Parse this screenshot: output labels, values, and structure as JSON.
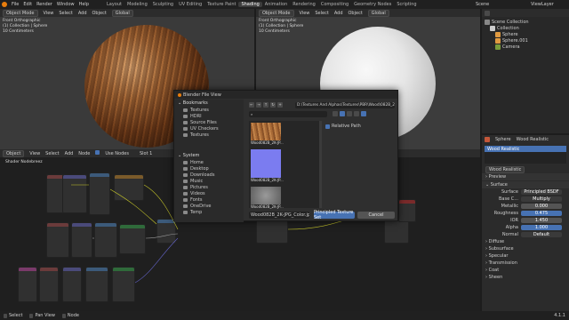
{
  "menu": [
    "File",
    "Edit",
    "Render",
    "Window",
    "Help"
  ],
  "workspaces": [
    "Layout",
    "Modeling",
    "Sculpting",
    "UV Editing",
    "Texture Paint",
    "Shading",
    "Animation",
    "Rendering",
    "Compositing",
    "Geometry Nodes",
    "Scripting"
  ],
  "active_workspace": "Shading",
  "scene": "Scene",
  "view_layer": "ViewLayer",
  "vp_left": {
    "mode": "Object Mode",
    "menus": [
      "View",
      "Select",
      "Add",
      "Object"
    ],
    "transform": "Global",
    "overlay_lines": [
      "Front Orthographic",
      "(1) Collection | Sphere",
      "10 Centimeters"
    ]
  },
  "vp_right": {
    "mode": "Object Mode",
    "menus": [
      "View",
      "Select",
      "Add",
      "Object"
    ],
    "transform": "Global",
    "overlay_lines": [
      "Front Orthographic",
      "(1) Collection | Sphere",
      "10 Centimeters"
    ]
  },
  "node_editor": {
    "object_dropdown": "Object",
    "menus": [
      "View",
      "Select",
      "Add",
      "Node"
    ],
    "use_nodes": "Use Nodes",
    "slot": "Slot 1",
    "breadcrumb": "Shader Nodebreez"
  },
  "outliner": {
    "title": "Scene Collection",
    "rows": [
      "Collection",
      "Sphere",
      "Sphere.001",
      "Camera"
    ]
  },
  "properties": {
    "object": "Sphere",
    "material": "Wood Realistic",
    "material_slot": "Wood Realistic",
    "sections": [
      "Preview",
      "Surface"
    ],
    "surface_label": "Surface",
    "surface_value": "Principled BSDF",
    "base_color_label": "Base C...",
    "base_color_value": "Multiply",
    "rows": [
      {
        "label": "Metallic",
        "value": "0.000"
      },
      {
        "label": "Roughness",
        "value": "0.475"
      },
      {
        "label": "IOR",
        "value": "1.450"
      },
      {
        "label": "Alpha",
        "value": "1.000"
      }
    ],
    "normal_label": "Normal",
    "normal_value": "Default",
    "subsections": [
      "Diffuse",
      "Subsurface",
      "Specular",
      "Transmission",
      "Coat",
      "Sheen"
    ]
  },
  "file_dialog": {
    "title": "Blender File View",
    "path": "D:\\Textures And Alphas\\Textures\\PBR\\Wood\\082B_2K-JPG\\",
    "search_placeholder": "",
    "bookmarks_title": "Bookmarks",
    "bookmarks": [
      "Textures",
      "HDRI",
      "Source Files",
      "UV Checkers",
      "Textures"
    ],
    "system_title": "System",
    "system": [
      "Home",
      "Desktop",
      "Downloads",
      "Music",
      "Pictures",
      "Videos",
      "Fonts",
      "OneDrive",
      "Temp"
    ],
    "files": [
      "Wood082B_2K-JP...",
      "Wood082B_2K-JP...",
      "Wood082B_2K-JP..."
    ],
    "relative_path": "Relative Path",
    "filename": "Wood082B_2K-JPG_Color.jpg",
    "confirm": "Principled Texture Set",
    "cancel": "Cancel"
  },
  "statusbar": {
    "items": [
      "Select",
      "Pan View",
      "Node"
    ],
    "version": "4.1.1"
  }
}
